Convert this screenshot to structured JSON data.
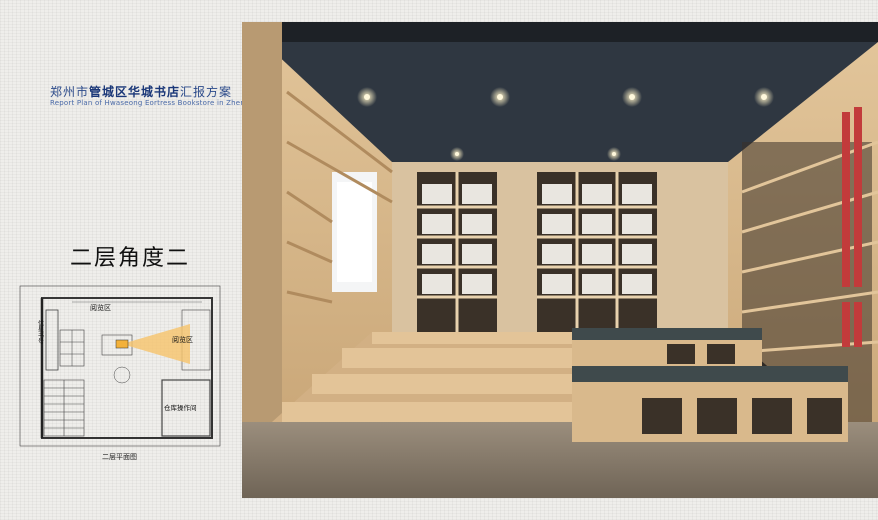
{
  "header": {
    "title_cn_prefix": "郑州市",
    "title_cn_bold": "管城区华城书店",
    "title_cn_suffix": "汇报方案",
    "title_en": "Report Plan of Hwaseong Eortress Bookstore in Zhengzhou district"
  },
  "section": {
    "title": "二层角度二"
  },
  "floor_plan": {
    "caption": "二层平面图",
    "labels": {
      "reading_area_top": "阅览区",
      "reading_area_right": "阅览区",
      "book_area": "优星书号",
      "storage": "仓库操作间"
    },
    "colors": {
      "walls": "#333333",
      "view_cone": "#f3b13a"
    }
  },
  "render": {
    "description_icon": "bookstore-interior-render",
    "colors": {
      "ceiling": "#2f3741",
      "wood": "#d9b98c",
      "floor": "#8a7c6c",
      "cushion": "#3f4a4c"
    }
  }
}
